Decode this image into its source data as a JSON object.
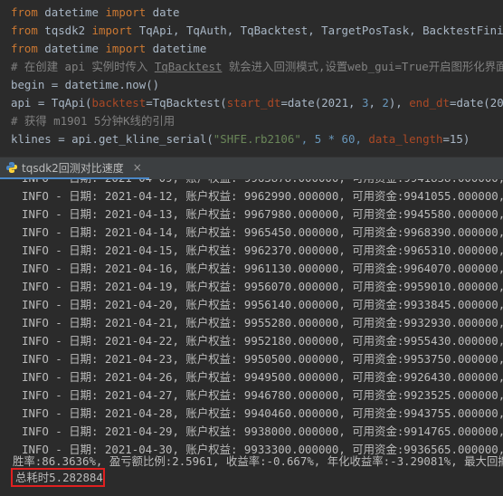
{
  "editor": {
    "lines": [
      {
        "kw1": "from",
        "mid1": " datetime ",
        "kw2": "import",
        "rest": " date"
      },
      {
        "kw1": "from",
        "mid1": " tqsdk2 ",
        "kw2": "import",
        "rest": " TqApi, TqAuth, TqBacktest, TargetPosTask, BacktestFinished"
      },
      {
        "kw1": "from",
        "mid1": " datetime ",
        "kw2": "import",
        "rest": " datetime"
      }
    ],
    "comment1_prefix": "# 在创建 api 实例时传入 ",
    "comment1_link": "TqBacktest",
    "comment1_suffix": " 就会进入回测模式,设置web_gui=True开启图形化界面",
    "begin_line": "begin = datetime.now()",
    "api_line": {
      "lhs": "api = TqApi(",
      "kwarg1": "backtest",
      "eq1": "=TqBacktest(",
      "kwarg2": "start_dt",
      "eq2": "=date(2021, ",
      "n1": "3",
      "c1": ", ",
      "n2": "2",
      "c2": "), ",
      "kwarg3": "end_dt",
      "eq3": "=date(2021, ",
      "n3": "5",
      "c3": ", ",
      "n4": "2",
      "tail": "))"
    },
    "comment2": "# 获得 m1901 5分钟K线的引用",
    "klines_line": {
      "lhs": "klines = api.get_kline_serial(",
      "str1": "\"SHFE.rb2106\"",
      "mid": ", 5 * 60, ",
      "kwarg": "data_length",
      "tail": "=15)"
    }
  },
  "run_tab": {
    "title": "tqsdk2回测对比速度",
    "close": "×"
  },
  "console": {
    "partial_top": "INFO - 日期: 2021-04-09, 账户权益: 9963878.000000, 可用资金:9941858.000000, 浮动盈",
    "log_lines": [
      "INFO - 日期: 2021-04-12, 账户权益: 9962990.000000, 可用资金:9941055.000000, 浮动盈",
      "INFO - 日期: 2021-04-13, 账户权益: 9967980.000000, 可用资金:9945580.000000, 浮动盈",
      "INFO - 日期: 2021-04-14, 账户权益: 9965450.000000, 可用资金:9968390.000000, 浮动盈",
      "INFO - 日期: 2021-04-15, 账户权益: 9962370.000000, 可用资金:9965310.000000, 浮动盈",
      "INFO - 日期: 2021-04-16, 账户权益: 9961130.000000, 可用资金:9964070.000000, 浮动盈",
      "INFO - 日期: 2021-04-19, 账户权益: 9956070.000000, 可用资金:9959010.000000, 浮动盈",
      "INFO - 日期: 2021-04-20, 账户权益: 9956140.000000, 可用资金:9933845.000000, 浮动盈",
      "INFO - 日期: 2021-04-21, 账户权益: 9955280.000000, 可用资金:9932930.000000, 浮动盈",
      "INFO - 日期: 2021-04-22, 账户权益: 9952180.000000, 可用资金:9955430.000000, 浮动盈",
      "INFO - 日期: 2021-04-23, 账户权益: 9950500.000000, 可用资金:9953750.000000, 浮动盈",
      "INFO - 日期: 2021-04-26, 账户权益: 9949500.000000, 可用资金:9926430.000000, 浮动盈",
      "INFO - 日期: 2021-04-27, 账户权益: 9946780.000000, 可用资金:9923525.000000, 浮动盈",
      "INFO - 日期: 2021-04-28, 账户权益: 9940460.000000, 可用资金:9943755.000000, 浮动盈",
      "INFO - 日期: 2021-04-29, 账户权益: 9938000.000000, 可用资金:9914765.000000, 浮动盈",
      "INFO - 日期: 2021-04-30, 账户权益: 9933300.000000, 可用资金:9936565.000000, 浮动盈"
    ],
    "stats": "胜率:86.3636%, 盈亏额比例:2.5961, 收益率:-0.667%, 年化收益率:-3.29081%, 最大回撤:0.",
    "total_time": "总耗时5.282884"
  },
  "colors": {
    "background": "#2b2b2b",
    "highlight_box": "#e02020",
    "tab_underline": "#4a88c7"
  }
}
